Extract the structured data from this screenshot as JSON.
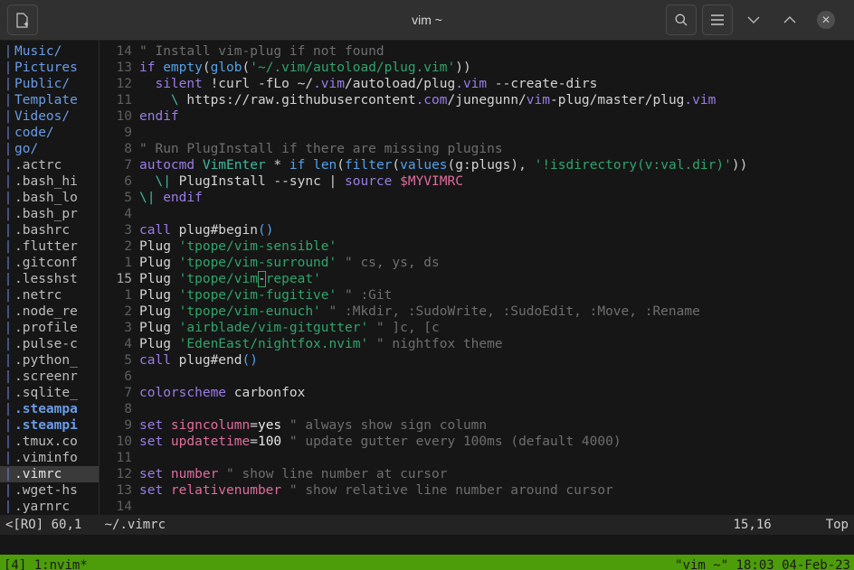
{
  "window": {
    "title": "vim ~",
    "buttons": {
      "new_tab": "new-tab",
      "search": "search",
      "menu": "menu",
      "minimize": "minimize",
      "maximize": "maximize",
      "close": "✕"
    }
  },
  "sidebar": {
    "items": [
      {
        "name": "Music/",
        "kind": "dir"
      },
      {
        "name": "Pictures",
        "kind": "dir"
      },
      {
        "name": "Public/",
        "kind": "dir"
      },
      {
        "name": "Template",
        "kind": "dir"
      },
      {
        "name": "Videos/",
        "kind": "dir"
      },
      {
        "name": "code/",
        "kind": "dir"
      },
      {
        "name": "go/",
        "kind": "dir"
      },
      {
        "name": ".actrc",
        "kind": "file"
      },
      {
        "name": ".bash_hi",
        "kind": "file"
      },
      {
        "name": ".bash_lo",
        "kind": "file"
      },
      {
        "name": ".bash_pr",
        "kind": "file"
      },
      {
        "name": ".bashrc",
        "kind": "file"
      },
      {
        "name": ".flutter",
        "kind": "file"
      },
      {
        "name": ".gitconf",
        "kind": "file"
      },
      {
        "name": ".lesshst",
        "kind": "file"
      },
      {
        "name": ".netrc",
        "kind": "file"
      },
      {
        "name": ".node_re",
        "kind": "file"
      },
      {
        "name": ".profile",
        "kind": "file"
      },
      {
        "name": ".pulse-c",
        "kind": "file"
      },
      {
        "name": ".python_",
        "kind": "file"
      },
      {
        "name": ".screenr",
        "kind": "file"
      },
      {
        "name": ".sqlite_",
        "kind": "file"
      },
      {
        "name": ".steampa",
        "kind": "link"
      },
      {
        "name": ".steampi",
        "kind": "link"
      },
      {
        "name": ".tmux.co",
        "kind": "file"
      },
      {
        "name": ".viminfo",
        "kind": "file"
      },
      {
        "name": ".vimrc",
        "kind": "cur"
      },
      {
        "name": ".wget-hs",
        "kind": "file"
      },
      {
        "name": ".yarnrc",
        "kind": "file"
      }
    ]
  },
  "editor": {
    "filename": "~/.vimrc",
    "lines": [
      {
        "num": "14",
        "cur": false,
        "tokens": [
          {
            "c": "cmt",
            "t": "\" Install vim-plug if not found"
          }
        ]
      },
      {
        "num": "13",
        "cur": false,
        "tokens": [
          {
            "c": "kw",
            "t": "if "
          },
          {
            "c": "fn",
            "t": "empty"
          },
          {
            "c": "op",
            "t": "("
          },
          {
            "c": "fn",
            "t": "glob"
          },
          {
            "c": "op",
            "t": "("
          },
          {
            "c": "str",
            "t": "'~/.vim/autoload/plug.vim'"
          },
          {
            "c": "op",
            "t": "))"
          }
        ]
      },
      {
        "num": "12",
        "cur": false,
        "tokens": [
          {
            "c": "txt",
            "t": "  "
          },
          {
            "c": "kw",
            "t": "silent "
          },
          {
            "c": "txt",
            "t": "!curl -fLo ~/"
          },
          {
            "c": "kw",
            "t": ".vim"
          },
          {
            "c": "txt",
            "t": "/autoload/plug"
          },
          {
            "c": "kw",
            "t": ".vim"
          },
          {
            "c": "txt",
            "t": " --create-dirs"
          }
        ]
      },
      {
        "num": "11",
        "cur": false,
        "tokens": [
          {
            "c": "txt",
            "t": "    "
          },
          {
            "c": "typ",
            "t": "\\"
          },
          {
            "c": "txt",
            "t": " https://raw.githubusercontent"
          },
          {
            "c": "kw",
            "t": ".com"
          },
          {
            "c": "txt",
            "t": "/junegunn/"
          },
          {
            "c": "kw",
            "t": "vim"
          },
          {
            "c": "txt",
            "t": "-plug/master/plug"
          },
          {
            "c": "kw",
            "t": ".vim"
          }
        ]
      },
      {
        "num": "10",
        "cur": false,
        "tokens": [
          {
            "c": "kw",
            "t": "endif"
          }
        ]
      },
      {
        "num": "9",
        "cur": false,
        "tokens": []
      },
      {
        "num": "8",
        "cur": false,
        "tokens": [
          {
            "c": "cmt",
            "t": "\" Run PlugInstall if there are missing plugins"
          }
        ]
      },
      {
        "num": "7",
        "cur": false,
        "tokens": [
          {
            "c": "kw",
            "t": "autocmd "
          },
          {
            "c": "typ",
            "t": "VimEnter"
          },
          {
            "c": "op",
            "t": " * "
          },
          {
            "c": "fn",
            "t": "if "
          },
          {
            "c": "fn",
            "t": "len"
          },
          {
            "c": "op",
            "t": "("
          },
          {
            "c": "fn",
            "t": "filter"
          },
          {
            "c": "op",
            "t": "("
          },
          {
            "c": "fn",
            "t": "values"
          },
          {
            "c": "op",
            "t": "("
          },
          {
            "c": "txt",
            "t": "g:plugs"
          },
          {
            "c": "op",
            "t": "), "
          },
          {
            "c": "str",
            "t": "'!isdirectory(v:val.dir)'"
          },
          {
            "c": "op",
            "t": "))"
          }
        ]
      },
      {
        "num": "6",
        "cur": false,
        "tokens": [
          {
            "c": "txt",
            "t": "  "
          },
          {
            "c": "typ",
            "t": "\\|"
          },
          {
            "c": "txt",
            "t": " PlugInstall --sync "
          },
          {
            "c": "op",
            "t": "| "
          },
          {
            "c": "kw",
            "t": "source "
          },
          {
            "c": "var",
            "t": "$MYVIMRC"
          }
        ]
      },
      {
        "num": "5",
        "cur": false,
        "tokens": [
          {
            "c": "typ",
            "t": "\\|"
          },
          {
            "c": "kw",
            "t": " endif"
          }
        ]
      },
      {
        "num": "4",
        "cur": false,
        "tokens": []
      },
      {
        "num": "3",
        "cur": false,
        "tokens": [
          {
            "c": "kw",
            "t": "call "
          },
          {
            "c": "txt",
            "t": "plug#begin"
          },
          {
            "c": "fn",
            "t": "()"
          }
        ]
      },
      {
        "num": "2",
        "cur": false,
        "tokens": [
          {
            "c": "txt",
            "t": "Plug "
          },
          {
            "c": "str",
            "t": "'tpope/vim-sensible'"
          }
        ]
      },
      {
        "num": "1",
        "cur": false,
        "tokens": [
          {
            "c": "txt",
            "t": "Plug "
          },
          {
            "c": "str",
            "t": "'tpope/vim-surround'"
          },
          {
            "c": "cmt",
            "t": " \" cs, ys, ds"
          }
        ]
      },
      {
        "num": "15",
        "cur": true,
        "tokens": [
          {
            "c": "txt",
            "t": "Plug "
          },
          {
            "c": "str",
            "t": "'tpope/vim"
          },
          {
            "c": "cursor",
            "t": "-"
          },
          {
            "c": "str",
            "t": "repeat'"
          }
        ]
      },
      {
        "num": "1",
        "cur": false,
        "tokens": [
          {
            "c": "txt",
            "t": "Plug "
          },
          {
            "c": "str",
            "t": "'tpope/vim-fugitive'"
          },
          {
            "c": "cmt",
            "t": " \" :Git"
          }
        ]
      },
      {
        "num": "2",
        "cur": false,
        "tokens": [
          {
            "c": "txt",
            "t": "Plug "
          },
          {
            "c": "str",
            "t": "'tpope/vim-eunuch'"
          },
          {
            "c": "cmt",
            "t": " \" :Mkdir, :SudoWrite, :SudoEdit, :Move, :Rename"
          }
        ]
      },
      {
        "num": "3",
        "cur": false,
        "tokens": [
          {
            "c": "txt",
            "t": "Plug "
          },
          {
            "c": "str",
            "t": "'airblade/vim-gitgutter'"
          },
          {
            "c": "cmt",
            "t": " \" ]c, [c"
          }
        ]
      },
      {
        "num": "4",
        "cur": false,
        "tokens": [
          {
            "c": "txt",
            "t": "Plug "
          },
          {
            "c": "str",
            "t": "'EdenEast/nightfox.nvim'"
          },
          {
            "c": "cmt",
            "t": " \" nightfox theme"
          }
        ]
      },
      {
        "num": "5",
        "cur": false,
        "tokens": [
          {
            "c": "kw",
            "t": "call "
          },
          {
            "c": "txt",
            "t": "plug#end"
          },
          {
            "c": "fn",
            "t": "()"
          }
        ]
      },
      {
        "num": "6",
        "cur": false,
        "tokens": []
      },
      {
        "num": "7",
        "cur": false,
        "tokens": [
          {
            "c": "kw",
            "t": "colorscheme "
          },
          {
            "c": "txt",
            "t": "carbonfox"
          }
        ]
      },
      {
        "num": "8",
        "cur": false,
        "tokens": []
      },
      {
        "num": "9",
        "cur": false,
        "tokens": [
          {
            "c": "kw",
            "t": "set "
          },
          {
            "c": "var",
            "t": "signcolumn"
          },
          {
            "c": "op",
            "t": "="
          },
          {
            "c": "num",
            "t": "yes"
          },
          {
            "c": "cmt",
            "t": " \" always show sign column"
          }
        ]
      },
      {
        "num": "10",
        "cur": false,
        "tokens": [
          {
            "c": "kw",
            "t": "set "
          },
          {
            "c": "var",
            "t": "updatetime"
          },
          {
            "c": "op",
            "t": "="
          },
          {
            "c": "num",
            "t": "100"
          },
          {
            "c": "cmt",
            "t": " \" update gutter every 100ms (default 4000)"
          }
        ]
      },
      {
        "num": "11",
        "cur": false,
        "tokens": []
      },
      {
        "num": "12",
        "cur": false,
        "tokens": [
          {
            "c": "kw",
            "t": "set "
          },
          {
            "c": "var",
            "t": "number"
          },
          {
            "c": "cmt",
            "t": " \" show line number at cursor"
          }
        ]
      },
      {
        "num": "13",
        "cur": false,
        "tokens": [
          {
            "c": "kw",
            "t": "set "
          },
          {
            "c": "var",
            "t": "relativenumber"
          },
          {
            "c": "cmt",
            "t": " \" show relative line number around cursor"
          }
        ]
      },
      {
        "num": "14",
        "cur": false,
        "tokens": []
      }
    ]
  },
  "statusline": {
    "flags": "<[RO]",
    "size": "60,1",
    "path": "~/.vimrc",
    "position": "15,16",
    "scroll": "Top"
  },
  "tmux": {
    "session": "[4]",
    "window": "1:nvim*",
    "right": "\"vim ~\" 18:03 04-Feb-23"
  },
  "colors": {
    "titlebar_bg": "#303030",
    "terminal_bg": "#161616",
    "tmux_bg": "#4d9c0a",
    "status_bg": "#232323",
    "dir_blue": "#6a9ce8",
    "string_green": "#30a46c",
    "keyword_purple": "#9a7ce8",
    "var_pink": "#e06c9e",
    "comment_gray": "#6e6e6e",
    "cursor_green": "#3fa45f"
  }
}
